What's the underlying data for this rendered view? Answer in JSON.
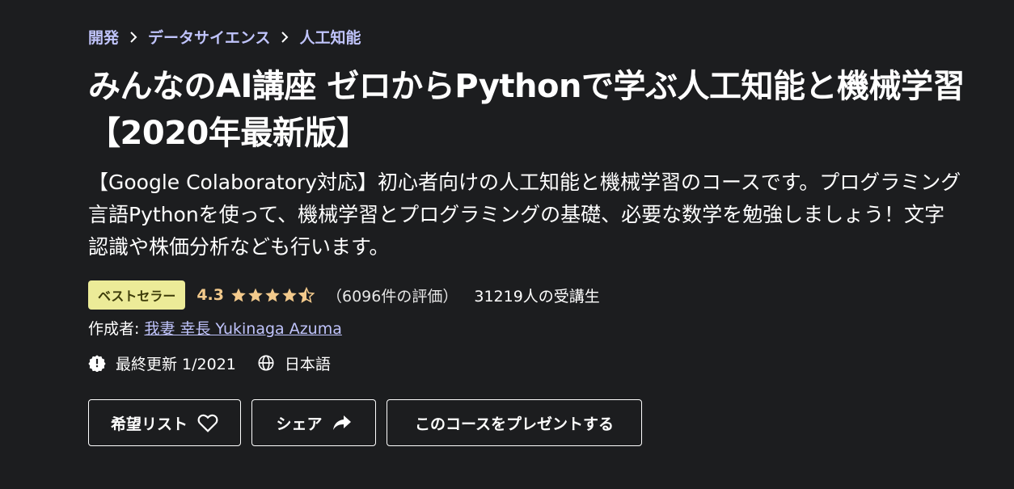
{
  "breadcrumb": {
    "items": [
      "開発",
      "データサイエンス",
      "人工知能"
    ]
  },
  "course": {
    "title": "みんなのAI講座 ゼロからPythonで学ぶ人工知能と機械学習 【2020年最新版】",
    "subtitle": "【Google Colaboratory対応】初心者向けの人工知能と機械学習のコースです。プログラミング言語Pythonを使って、機械学習とプログラミングの基礎、必要な数学を勉強しましょう！文字認識や株価分析なども行います。"
  },
  "rating": {
    "badge": "ベストセラー",
    "value": "4.3",
    "stars_out_of_5": 4.3,
    "count_text": "（6096件の評価）",
    "students_text": "31219人の受講生"
  },
  "author": {
    "label": "作成者:",
    "name": "我妻 幸長 Yukinaga Azuma"
  },
  "meta": {
    "last_updated": "最終更新 1/2021",
    "language": "日本語"
  },
  "buttons": {
    "wishlist": "希望リスト",
    "share": "シェア",
    "gift": "このコースをプレゼントする"
  },
  "colors": {
    "background": "#1c1d1f",
    "link": "#c0c4fc",
    "badge_bg": "#eceb98",
    "star": "#f3ca8c"
  }
}
